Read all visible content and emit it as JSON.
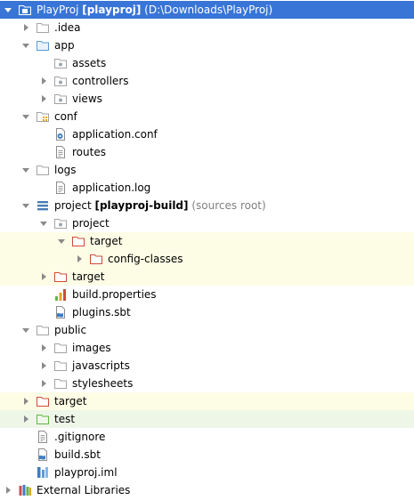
{
  "tree": {
    "rows": [
      {
        "name": "PlayProj",
        "module": "[playproj]",
        "path": "(D:\\Downloads\\PlayProj)",
        "level": 0,
        "arrow": "expanded",
        "icon": "module-folder-icon",
        "selected": true
      },
      {
        "label": ".idea",
        "level": 1,
        "arrow": "collapsed",
        "icon": "folder-icon"
      },
      {
        "label": "app",
        "level": 1,
        "arrow": "expanded",
        "icon": "source-folder-icon"
      },
      {
        "label": "assets",
        "level": 2,
        "arrow": "none",
        "icon": "package-icon"
      },
      {
        "label": "controllers",
        "level": 2,
        "arrow": "collapsed",
        "icon": "package-icon"
      },
      {
        "label": "views",
        "level": 2,
        "arrow": "collapsed",
        "icon": "package-icon"
      },
      {
        "label": "conf",
        "level": 1,
        "arrow": "expanded",
        "icon": "resources-folder-icon"
      },
      {
        "label": "application.conf",
        "level": 2,
        "arrow": "none",
        "icon": "config-file-icon"
      },
      {
        "label": "routes",
        "level": 2,
        "arrow": "none",
        "icon": "text-file-icon"
      },
      {
        "label": "logs",
        "level": 1,
        "arrow": "expanded",
        "icon": "folder-icon"
      },
      {
        "label": "application.log",
        "level": 2,
        "arrow": "none",
        "icon": "text-file-icon"
      },
      {
        "name": "project",
        "module": "[playproj-build]",
        "path": "(sources root)",
        "level": 1,
        "arrow": "expanded",
        "icon": "module-stack-icon"
      },
      {
        "label": "project",
        "level": 2,
        "arrow": "expanded",
        "icon": "package-icon"
      },
      {
        "label": "target",
        "level": 3,
        "arrow": "expanded",
        "icon": "excluded-folder-icon",
        "excluded": true
      },
      {
        "label": "config-classes",
        "level": 4,
        "arrow": "collapsed",
        "icon": "excluded-folder-icon",
        "excluded": true
      },
      {
        "label": "target",
        "level": 2,
        "arrow": "collapsed",
        "icon": "excluded-folder-icon",
        "excluded": true
      },
      {
        "label": "build.properties",
        "level": 2,
        "arrow": "none",
        "icon": "properties-file-icon"
      },
      {
        "label": "plugins.sbt",
        "level": 2,
        "arrow": "none",
        "icon": "sbt-file-icon"
      },
      {
        "label": "public",
        "level": 1,
        "arrow": "expanded",
        "icon": "folder-icon"
      },
      {
        "label": "images",
        "level": 2,
        "arrow": "collapsed",
        "icon": "folder-icon"
      },
      {
        "label": "javascripts",
        "level": 2,
        "arrow": "collapsed",
        "icon": "folder-icon"
      },
      {
        "label": "stylesheets",
        "level": 2,
        "arrow": "collapsed",
        "icon": "folder-icon"
      },
      {
        "label": "target",
        "level": 1,
        "arrow": "collapsed",
        "icon": "excluded-folder-icon",
        "excluded": true
      },
      {
        "label": "test",
        "level": 1,
        "arrow": "collapsed",
        "icon": "test-folder-icon",
        "testroot": true
      },
      {
        "label": ".gitignore",
        "level": 1,
        "arrow": "none",
        "icon": "text-file-icon"
      },
      {
        "label": "build.sbt",
        "level": 1,
        "arrow": "none",
        "icon": "sbt-file-icon"
      },
      {
        "label": "playproj.iml",
        "level": 1,
        "arrow": "none",
        "icon": "iml-file-icon"
      },
      {
        "label": "External Libraries",
        "level": 0,
        "arrow": "collapsed",
        "icon": "libraries-icon"
      }
    ]
  },
  "colors": {
    "selection": "#3875d7",
    "excluded_row": "#fdfde6",
    "test_row": "#eef6e8",
    "folder": "#a3a3a3",
    "source_folder": "#5b9bd5",
    "excluded_folder": "#d04a3a",
    "test_folder": "#62b543",
    "package_dot": "#9aa7b0"
  }
}
